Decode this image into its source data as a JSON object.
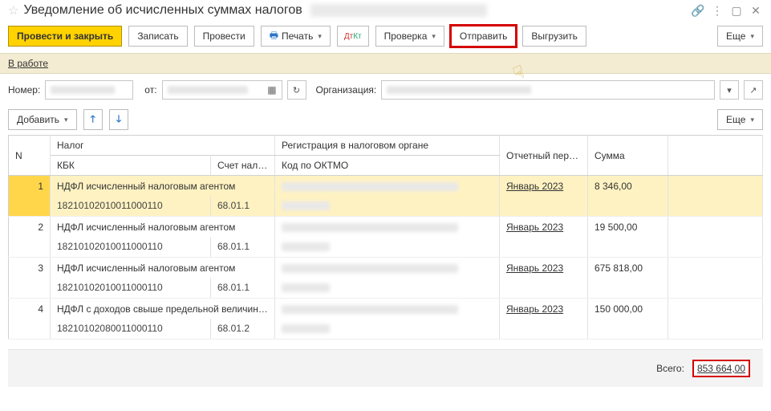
{
  "title": "Уведомление об исчисленных суммах налогов",
  "toolbar": {
    "post_close": "Провести и закрыть",
    "write": "Записать",
    "post": "Провести",
    "print": "Печать",
    "check": "Проверка",
    "send": "Отправить",
    "export": "Выгрузить",
    "more": "Еще"
  },
  "status": "В работе",
  "form": {
    "num_label": "Номер:",
    "from_label": "от:",
    "org_label": "Организация:"
  },
  "sub": {
    "add": "Добавить",
    "more": "Еще"
  },
  "columns": {
    "n": "N",
    "tax": "Налог",
    "kbk": "КБК",
    "acct": "Счет налога",
    "reg": "Регистрация в налоговом органе",
    "oktmo": "Код по ОКТМО",
    "period": "Отчетный период",
    "sum": "Сумма"
  },
  "rows": [
    {
      "n": "1",
      "tax": "НДФЛ исчисленный налоговым агентом",
      "kbk": "18210102010011000110",
      "acct": "68.01.1",
      "period": "Январь 2023",
      "sum": "8 346,00"
    },
    {
      "n": "2",
      "tax": "НДФЛ исчисленный налоговым агентом",
      "kbk": "18210102010011000110",
      "acct": "68.01.1",
      "period": "Январь 2023",
      "sum": "19 500,00"
    },
    {
      "n": "3",
      "tax": "НДФЛ исчисленный налоговым агентом",
      "kbk": "18210102010011000110",
      "acct": "68.01.1",
      "period": "Январь 2023",
      "sum": "675 818,00"
    },
    {
      "n": "4",
      "tax": "НДФЛ с доходов свыше предельной величин…",
      "kbk": "18210102080011000110",
      "acct": "68.01.2",
      "period": "Январь 2023",
      "sum": "150 000,00"
    }
  ],
  "footer": {
    "label": "Всего:",
    "total": "853 664,00"
  }
}
